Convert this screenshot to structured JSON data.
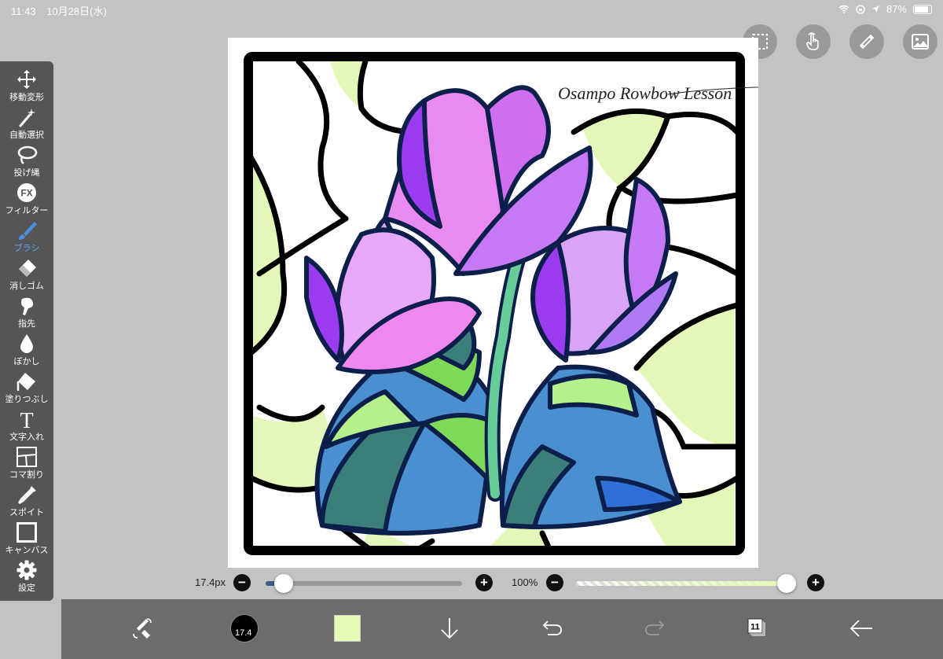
{
  "status": {
    "time": "11:43",
    "date": "10月28日(水)",
    "battery": "87%"
  },
  "tools": [
    {
      "label": "移動変形",
      "icon": "move-icon"
    },
    {
      "label": "自動選択",
      "icon": "magic-wand-icon"
    },
    {
      "label": "投げ縄",
      "icon": "lasso-icon"
    },
    {
      "label": "フィルター",
      "icon": "fx-icon"
    },
    {
      "label": "ブラシ",
      "icon": "brush-icon",
      "active": true
    },
    {
      "label": "消しゴム",
      "icon": "eraser-icon"
    },
    {
      "label": "指先",
      "icon": "smudge-icon"
    },
    {
      "label": "ぼかし",
      "icon": "blur-drop-icon"
    },
    {
      "label": "塗りつぶし",
      "icon": "fill-bucket-icon"
    },
    {
      "label": "文字入れ",
      "icon": "text-icon"
    },
    {
      "label": "コマ割り",
      "icon": "frame-divider-icon"
    },
    {
      "label": "スポイト",
      "icon": "eyedropper-icon"
    },
    {
      "label": "キャンバス",
      "icon": "canvas-icon"
    },
    {
      "label": "設定",
      "icon": "gear-icon"
    }
  ],
  "top_actions": [
    "selection-icon",
    "gesture-hand-icon",
    "ruler-icon",
    "image-icon"
  ],
  "fx_glyph": "FX",
  "text_tool_glyph": "T",
  "artwork": {
    "signature": "Osampo Rowbow Lesson",
    "accent_colors": [
      "#e3f8b8",
      "#e98af0",
      "#c678f5",
      "#9b3cf0",
      "#66cc99",
      "#4a90d0",
      "#7ed957",
      "#3c7f7a"
    ]
  },
  "brush_size_slider": {
    "value_label": "17.4px",
    "minus": "−",
    "plus": "+",
    "fraction": 0.09
  },
  "opacity_slider": {
    "value_label": "100%",
    "minus": "−",
    "plus": "+",
    "fraction": 1.0
  },
  "bottom_bar": {
    "brush_size_badge": "17.4",
    "current_color": "#e6fbb6",
    "layer_count": "11"
  }
}
